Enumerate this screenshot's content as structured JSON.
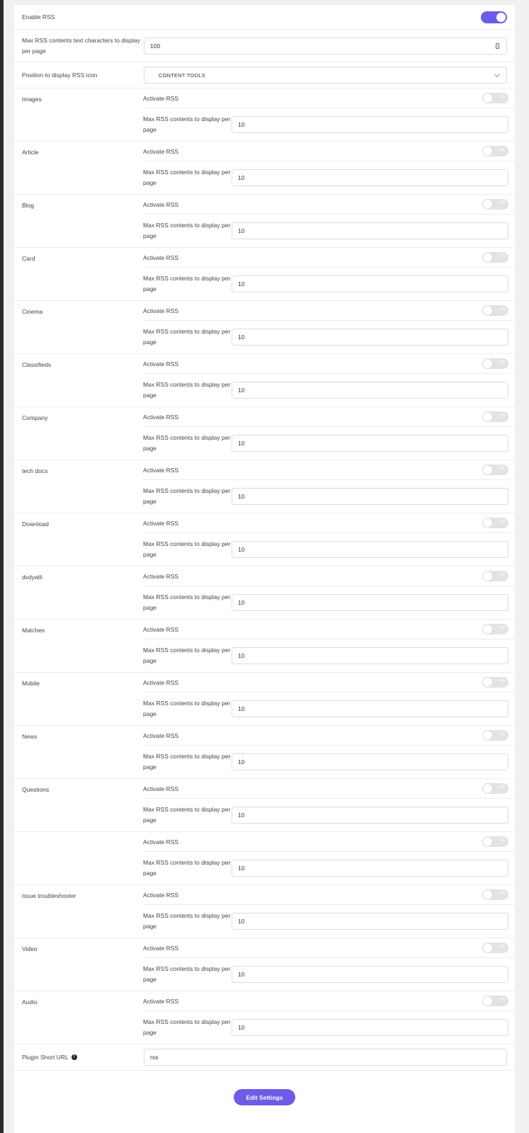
{
  "settings": {
    "enable_rss_label": "Enable RSS",
    "enable_rss_on": true,
    "max_chars_label": "Max RSS contents text characters to display per page",
    "max_chars_value": "100",
    "position_label": "Position to display RSS icon",
    "position_value": "CONTENT TOOLS",
    "short_url_label": "Plugin Short URL",
    "short_url_value": "rss",
    "edit_button_label": "Edit Settings"
  },
  "strings": {
    "activate_label": "Activate RSS",
    "toggle_off_text": "No",
    "max_contents_label": "Max RSS contents to display per page",
    "info_glyph": "!"
  },
  "sections": [
    {
      "title": "Images",
      "active": false,
      "max": "10"
    },
    {
      "title": "Article",
      "active": false,
      "max": "10"
    },
    {
      "title": "Blog",
      "active": false,
      "max": "10"
    },
    {
      "title": "Card",
      "active": false,
      "max": "10"
    },
    {
      "title": "Cinema",
      "active": false,
      "max": "10"
    },
    {
      "title": "Classifieds",
      "active": false,
      "max": "10"
    },
    {
      "title": "Company",
      "active": false,
      "max": "10"
    },
    {
      "title": "tech docs",
      "active": false,
      "max": "10"
    },
    {
      "title": "Download",
      "active": false,
      "max": "10"
    },
    {
      "title": "dvdyatli",
      "active": false,
      "max": "10"
    },
    {
      "title": "Matches",
      "active": false,
      "max": "10"
    },
    {
      "title": "Mobile",
      "active": false,
      "max": "10"
    },
    {
      "title": "News",
      "active": false,
      "max": "10"
    },
    {
      "title": "Questions",
      "active": false,
      "max": "10"
    },
    {
      "title": "",
      "active": false,
      "max": "10"
    },
    {
      "title": "issue troubleshooter",
      "active": false,
      "max": "10"
    },
    {
      "title": "Video",
      "active": false,
      "max": "10"
    },
    {
      "title": "Audio",
      "active": false,
      "max": "10"
    }
  ],
  "colors": {
    "accent": "#6c5ce7",
    "toggle_off": "#e3e3e3"
  }
}
